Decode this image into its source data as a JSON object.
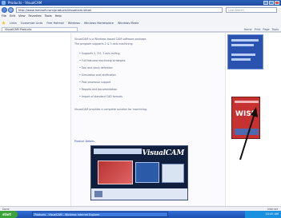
{
  "window": {
    "title": "Products - VisualCAM"
  },
  "toolbar": {
    "address": "http://www.mecsoft.com/products/visualcam.shtml",
    "search_placeholder": "Live Search",
    "menu": [
      "File",
      "Edit",
      "View",
      "Favorites",
      "Tools",
      "Help"
    ],
    "links": [
      "Links",
      "Customize Links",
      "Free Hotmail",
      "Windows",
      "Windows Marketplace",
      "Windows Media"
    ],
    "tab_label": "VisualCAM Products",
    "tools": [
      "Home",
      "Print",
      "Page",
      "Tools"
    ]
  },
  "content": {
    "paragraphs": [
      "VisualCAM is a Windows based CAM software package.",
      "The program supports 2 & 3 axis machining."
    ],
    "bullets": [
      "Supports 2, 2½, 3 axis milling",
      "Full featured machining strategies",
      "Tool and stock definition",
      "Simulation and verification",
      "Post processor support",
      "Reports and documentation",
      "Import of standard CAD formats"
    ],
    "detail_paragraph": "VisualCAM provides a complete solution for machining.",
    "caption": "Product Details",
    "banner_brand": "VisualCAM"
  },
  "sidebar": {
    "ad_title": "WISE"
  },
  "statusbar": {
    "left": "Done",
    "right": "Internet"
  },
  "taskbar": {
    "start": "start",
    "task": "Products - VisualCAM - Windows Internet Explorer",
    "clock": "10:45 AM"
  }
}
